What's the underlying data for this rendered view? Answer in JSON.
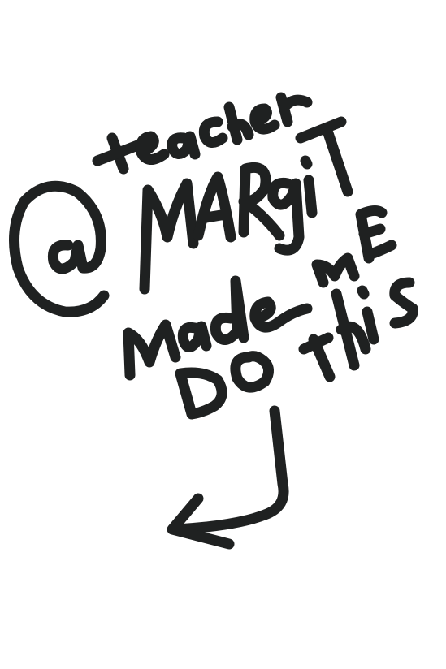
{
  "handwriting": {
    "line1": "teacher",
    "line2": "@MARgit",
    "line3": "Made Me",
    "line4": "Do this"
  },
  "colors": {
    "ink": "#1f2121",
    "background": "#ffffff"
  },
  "icons": {
    "arrow": "curved-arrow-left-icon"
  }
}
